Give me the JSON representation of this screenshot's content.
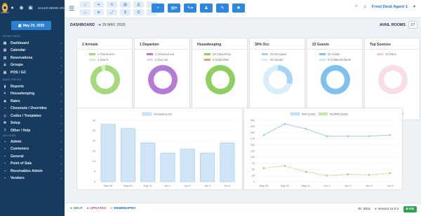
{
  "app": {
    "logo_caption": "HOSTAY",
    "property_name": "SALES DEMO 2011 - V15.0.2",
    "date_button": "May 29, 2025"
  },
  "sidebar": {
    "section_front": "FRONT DESK",
    "front_items": [
      {
        "label": "Dashboard",
        "icon": "grid-icon"
      },
      {
        "label": "Calendar",
        "icon": "calendar-icon"
      },
      {
        "label": "Reservations",
        "icon": "book-icon"
      },
      {
        "label": "Groups",
        "icon": "users-icon"
      },
      {
        "label": "POS / GC",
        "icon": "cart-icon"
      }
    ],
    "section_back": "BACK OFFICE",
    "back_items": [
      {
        "label": "Reports",
        "icon": "chart-icon"
      },
      {
        "label": "Housekeeping",
        "icon": "broom-icon"
      },
      {
        "label": "Rates",
        "icon": "tag-icon"
      },
      {
        "label": "Closeouts / Overrides",
        "icon": "lock-icon"
      },
      {
        "label": "Codes / Templates",
        "icon": "code-icon"
      },
      {
        "label": "Setup",
        "icon": "gear-icon"
      },
      {
        "label": "Other / Help",
        "icon": "help-icon"
      }
    ],
    "section_account": "ACCOUNT",
    "account_items": [
      {
        "label": "Admin",
        "icon": "admin-icon"
      },
      {
        "label": "Customers",
        "icon": "customers-icon"
      },
      {
        "label": "General",
        "icon": "general-icon"
      },
      {
        "label": "Point of Sale",
        "icon": "pos-icon"
      },
      {
        "label": "Receivables Admin",
        "icon": "receivables-icon"
      },
      {
        "label": "Vendors",
        "icon": "vendors-icon"
      }
    ]
  },
  "topbar": {
    "agent": "Front Desk Agent 1",
    "search_icon": "search-icon",
    "notify_icon": "bell-icon"
  },
  "dashboard": {
    "title": "DASHBOARD",
    "date": "29 MAY, 2025",
    "avail_label": "AVAIL ROOMS",
    "avail_value": "27"
  },
  "cards": [
    {
      "title": "2 Arrivals",
      "legend": [
        {
          "text": "2 Checked in",
          "color": "#a5d97b"
        },
        {
          "text": "1 Due in",
          "color": "#d6efc2"
        }
      ],
      "donut": [
        {
          "value": 0.95,
          "color": "#a5d97b"
        },
        {
          "value": 0.05,
          "color": "#d6efc2"
        }
      ],
      "link": "Arrivals"
    },
    {
      "title": "1 Departure",
      "legend": [
        {
          "text": "1 Checked out",
          "color": "#b57ad6"
        },
        {
          "text": "0 Due out",
          "color": "#e6d2f1"
        }
      ],
      "donut": [
        {
          "value": 1.0,
          "color": "#b57ad6"
        }
      ],
      "link": "Departures"
    },
    {
      "title": "Housekeeping",
      "legend": [
        {
          "text": "28 Clean/Insp",
          "color": "#8fcf5f"
        },
        {
          "text": "0 Dirty/Other",
          "color": "#f0a25a"
        }
      ],
      "donut": [
        {
          "value": 1.0,
          "color": "#8fcf5f"
        }
      ],
      "link": "Housekeeping"
    },
    {
      "title": "30% Occ",
      "legend": [
        {
          "text": "15 Occupied",
          "color": "#a6d4f2"
        },
        {
          "text": "45 Vacant",
          "color": "#d9eefb"
        }
      ],
      "donut": [
        {
          "value": 0.3,
          "color": "#a6d4f2"
        },
        {
          "value": 0.7,
          "color": "#d9eefb"
        }
      ],
      "link": "Property stats"
    },
    {
      "title": "22 Guests",
      "legend": [
        {
          "text": "22 Adults",
          "color": "#7fc1ec"
        },
        {
          "text": "0 Children/Infants",
          "color": "#cfe8f8"
        }
      ],
      "donut": [
        {
          "value": 1.0,
          "color": "#7fc1ec"
        }
      ],
      "link": "Guests"
    },
    {
      "title": "Top Sources",
      "legend": [
        {
          "text": "10 None",
          "color": "#f6c9d5"
        }
      ],
      "donut": [
        {
          "value": 1.0,
          "color": "#f9dde5"
        }
      ],
      "link": "Custom reports"
    }
  ],
  "chart_data": [
    {
      "type": "bar",
      "categories": [
        "May 28",
        "May 30",
        "May 31",
        "Jun 1",
        "Jun 2",
        "Jun 3",
        "Jun 4"
      ],
      "series": [
        {
          "name": "Occupancy (%)",
          "values": [
            28,
            26,
            19,
            14,
            16,
            14,
            19
          ]
        }
      ],
      "ylim": [
        0,
        30
      ],
      "yticks": [
        "0",
        "5",
        "10",
        "15",
        "20",
        "25",
        "30"
      ],
      "color": "#cfe5f6",
      "border": "#9cc9e8"
    },
    {
      "type": "line",
      "categories": [
        "May 28",
        "May 30",
        "May 31",
        "Jun 1",
        "Jun 2",
        "Jun 3",
        "Jun 4"
      ],
      "series": [
        {
          "name": "ADR (USD)",
          "values": [
            190,
            235,
            215,
            185,
            185,
            185,
            190
          ],
          "color": "#9fcbea"
        },
        {
          "name": "RevPAR (USD)",
          "values": [
            55,
            65,
            40,
            25,
            30,
            28,
            35
          ],
          "color": "#a5d97b"
        }
      ],
      "ylim": [
        0,
        250
      ],
      "yticks": [
        "0",
        "25",
        "50",
        "75",
        "100",
        "125",
        "150",
        "175",
        "200",
        "225",
        "250"
      ]
    }
  ],
  "footer": {
    "help": "HELP",
    "updates": "UPDATES",
    "webrez": "WEBREZPRO",
    "id": "ID: 3811",
    "version": "Version 11.0.2",
    "on": "ON"
  }
}
